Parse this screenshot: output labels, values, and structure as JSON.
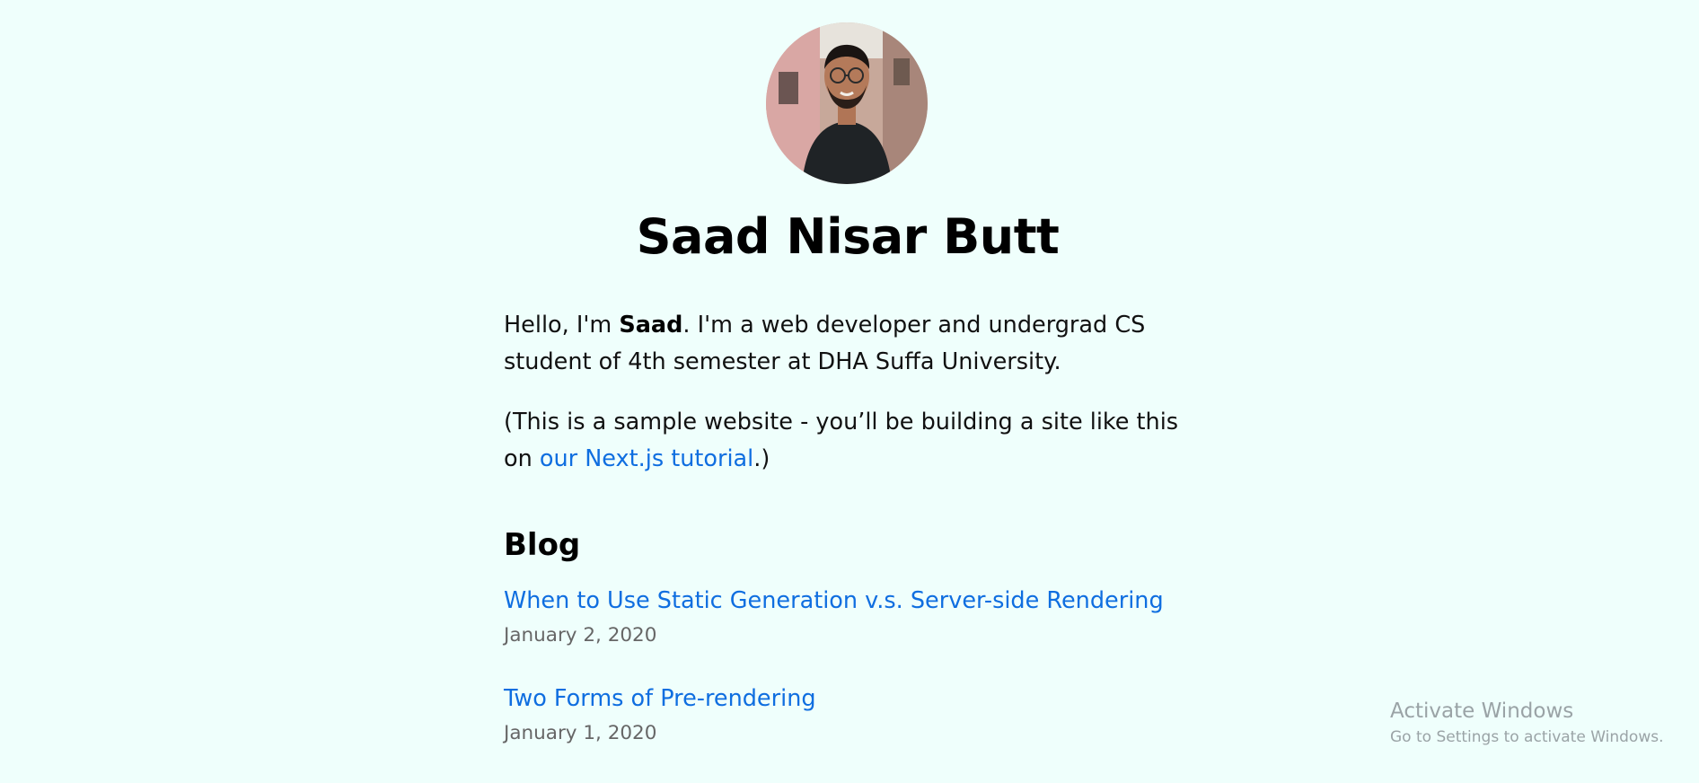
{
  "profile": {
    "name": "Saad Nisar Butt"
  },
  "intro": {
    "prefix": "Hello, I'm ",
    "name_bold": "Saad",
    "suffix": ". I'm a web developer and undergrad CS student of 4th semester at DHA Suffa University."
  },
  "sample_note": {
    "prefix": "(This is a sample website - you’ll be building a site like this on ",
    "link_text": "our Next.js tutorial",
    "suffix": ".)"
  },
  "blog": {
    "heading": "Blog",
    "posts": [
      {
        "title": "When to Use Static Generation v.s. Server-side Rendering",
        "date": "January 2, 2020"
      },
      {
        "title": "Two Forms of Pre-rendering",
        "date": "January 1, 2020"
      }
    ]
  },
  "watermark": {
    "title": "Activate Windows",
    "subtitle": "Go to Settings to activate Windows."
  },
  "colors": {
    "background": "#effffc",
    "link": "#0f6ee0",
    "date": "#666666"
  }
}
